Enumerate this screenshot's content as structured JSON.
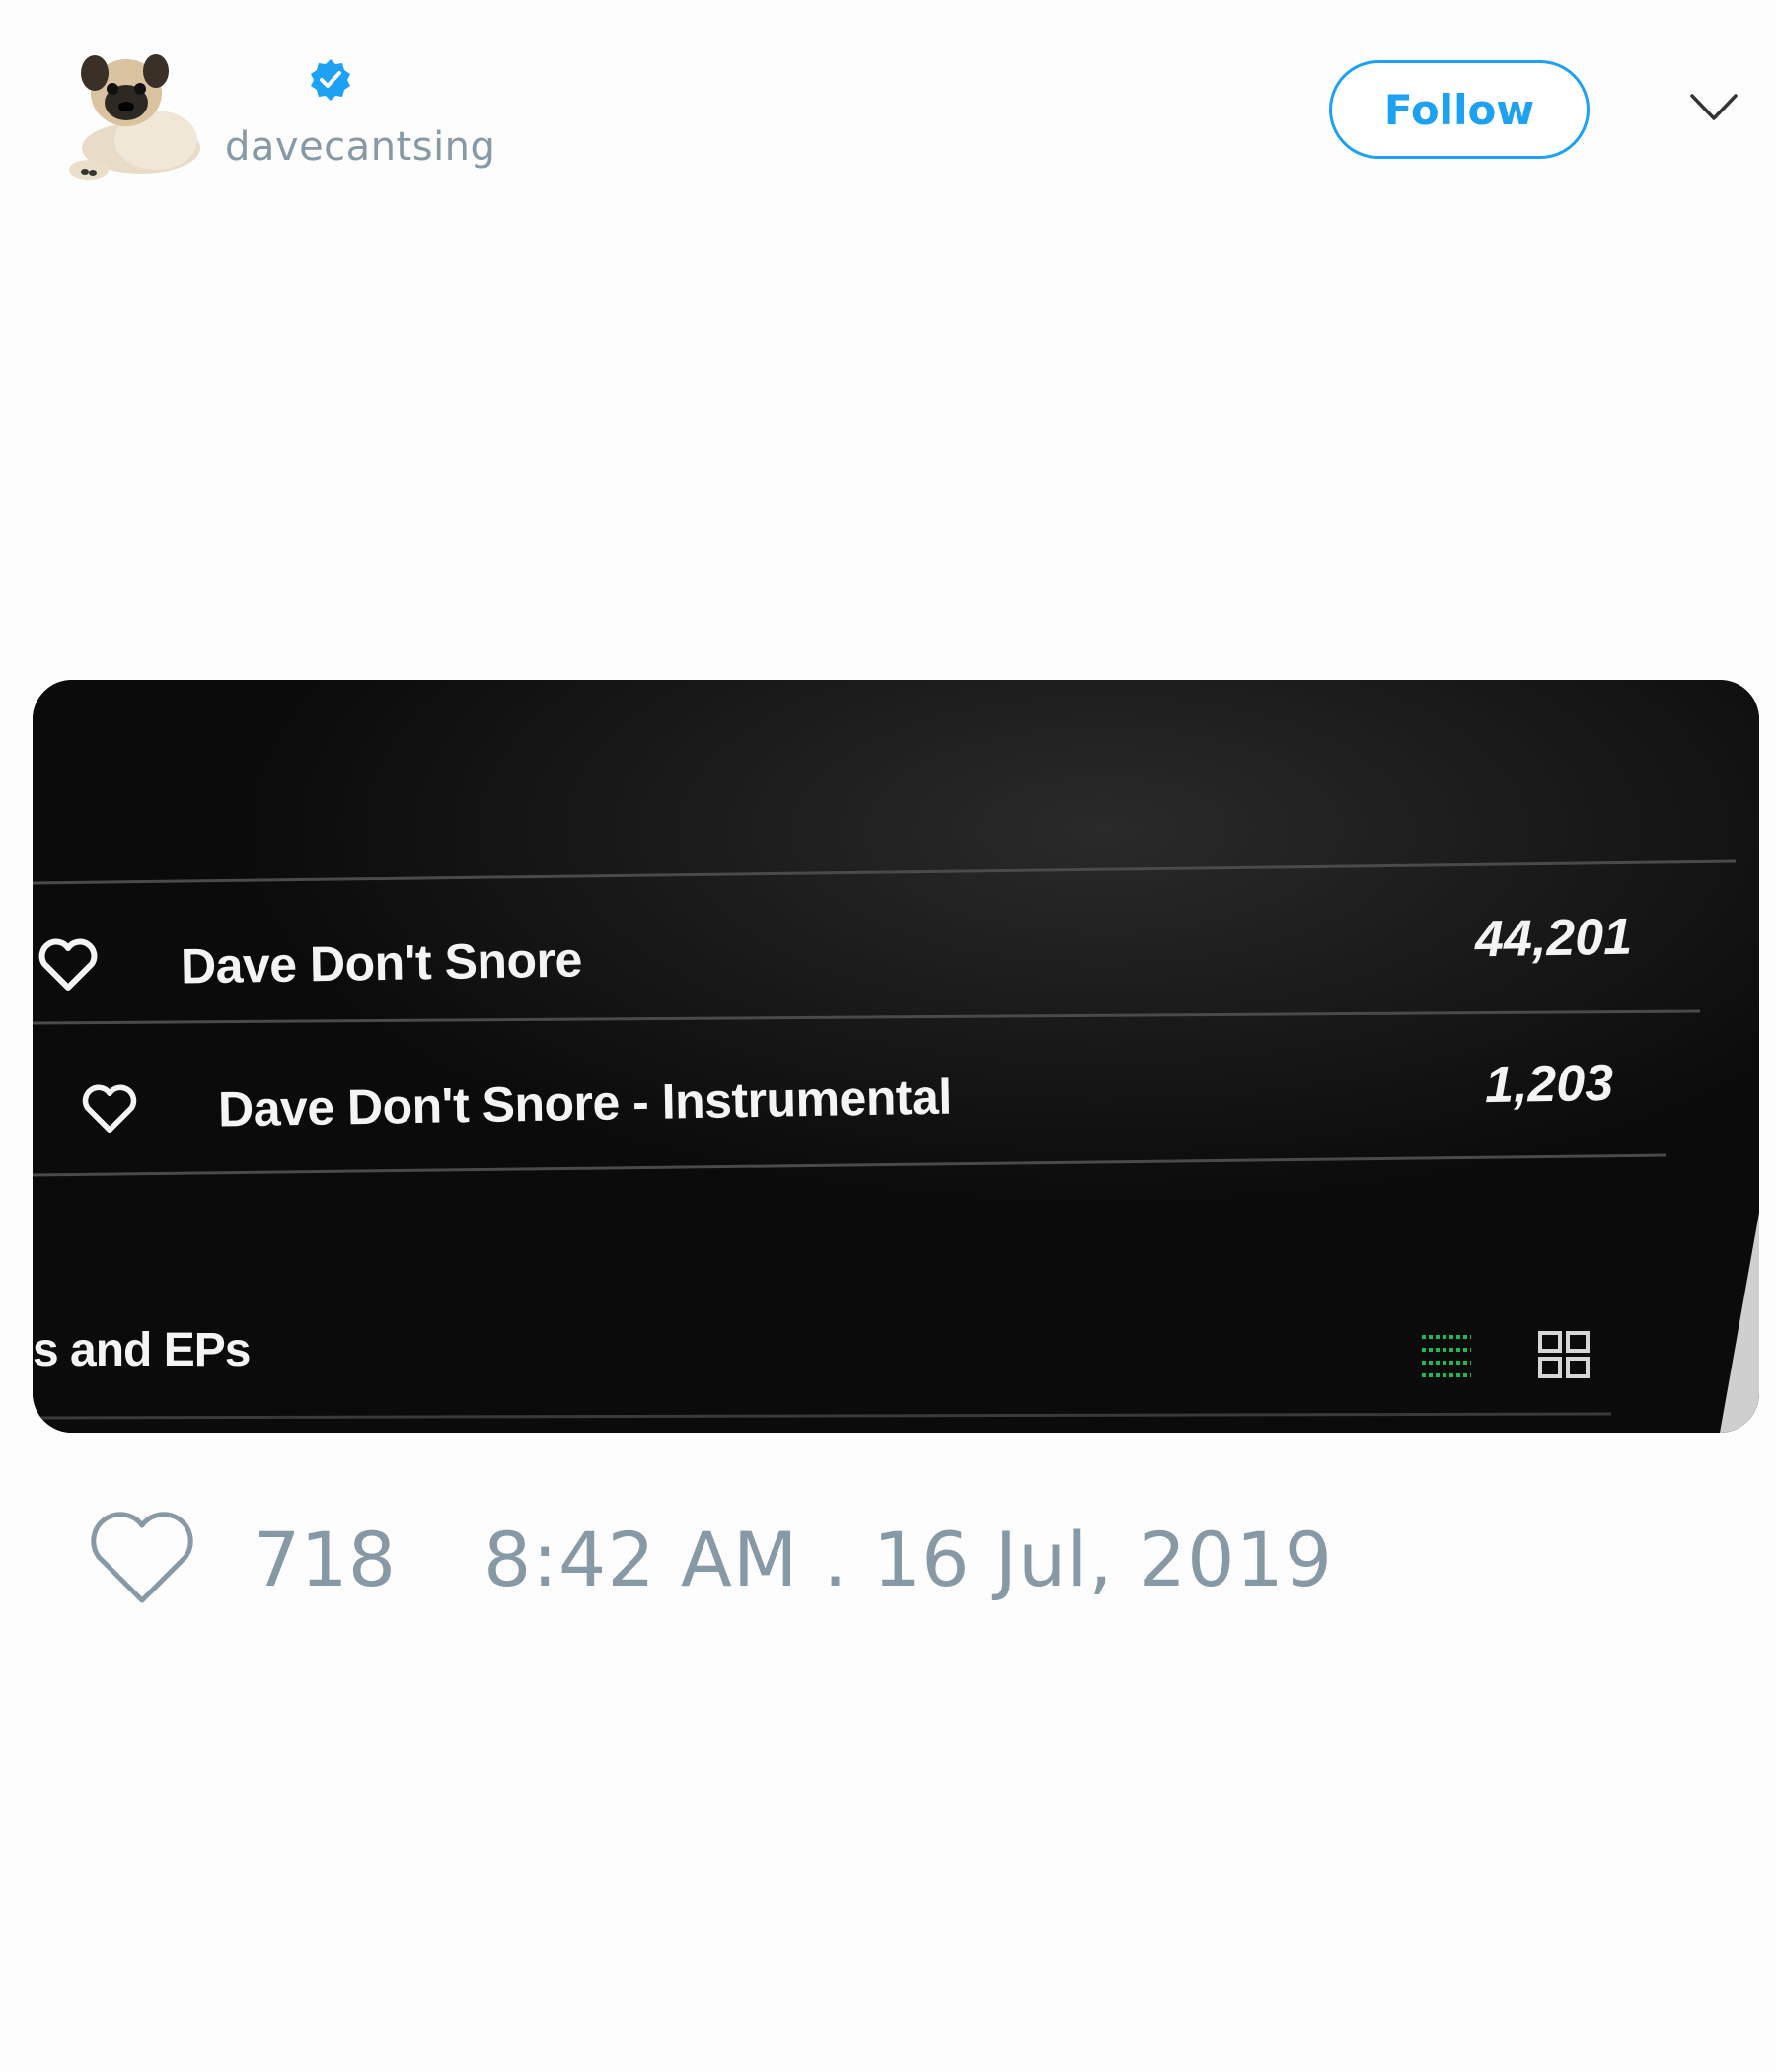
{
  "user": {
    "handle": "davecantsing",
    "verified": true,
    "avatar": "pug-avatar"
  },
  "header": {
    "follow_label": "Follow",
    "menu_icon": "chevron-down-icon"
  },
  "media": {
    "tracks": [
      {
        "title": "Dave Don't Snore",
        "count": "44,201"
      },
      {
        "title": "Dave Don't Snore - Instrumental",
        "count": "1,203"
      }
    ],
    "section_label": "s and EPs",
    "view_icons": [
      "list-view-icon",
      "grid-view-icon"
    ]
  },
  "footer": {
    "like_count": "718",
    "timestamp": "8:42 AM . 16 Jul, 2019"
  },
  "colors": {
    "accent": "#1da1f2",
    "muted": "#8899a6",
    "spotify_green": "#1db954"
  }
}
